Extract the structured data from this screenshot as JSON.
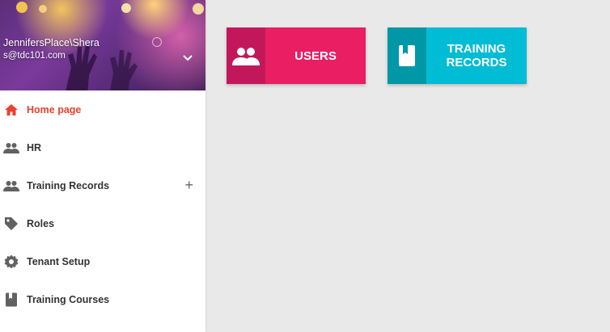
{
  "profile": {
    "name": "JennifersPlace\\Shera",
    "email": "s@tdc101.com"
  },
  "menu": {
    "items": [
      {
        "label": "Home page",
        "icon": "home-icon"
      },
      {
        "label": "HR",
        "icon": "people-icon"
      },
      {
        "label": "Training Records",
        "icon": "people-icon",
        "expand": "+"
      },
      {
        "label": "Roles",
        "icon": "tag-icon"
      },
      {
        "label": "Tenant Setup",
        "icon": "gear-icon"
      },
      {
        "label": "Training Courses",
        "icon": "book-icon"
      }
    ]
  },
  "tiles": [
    {
      "label": "USERS",
      "icon": "people-icon",
      "color": "#e91e63"
    },
    {
      "label": "TRAINING\nRECORDS",
      "icon": "book-icon",
      "color": "#00bcd4"
    }
  ],
  "colors": {
    "active": "#e8412e",
    "icon": "#616161",
    "users_tile": "#e91e63",
    "training_tile": "#00bcd4"
  }
}
